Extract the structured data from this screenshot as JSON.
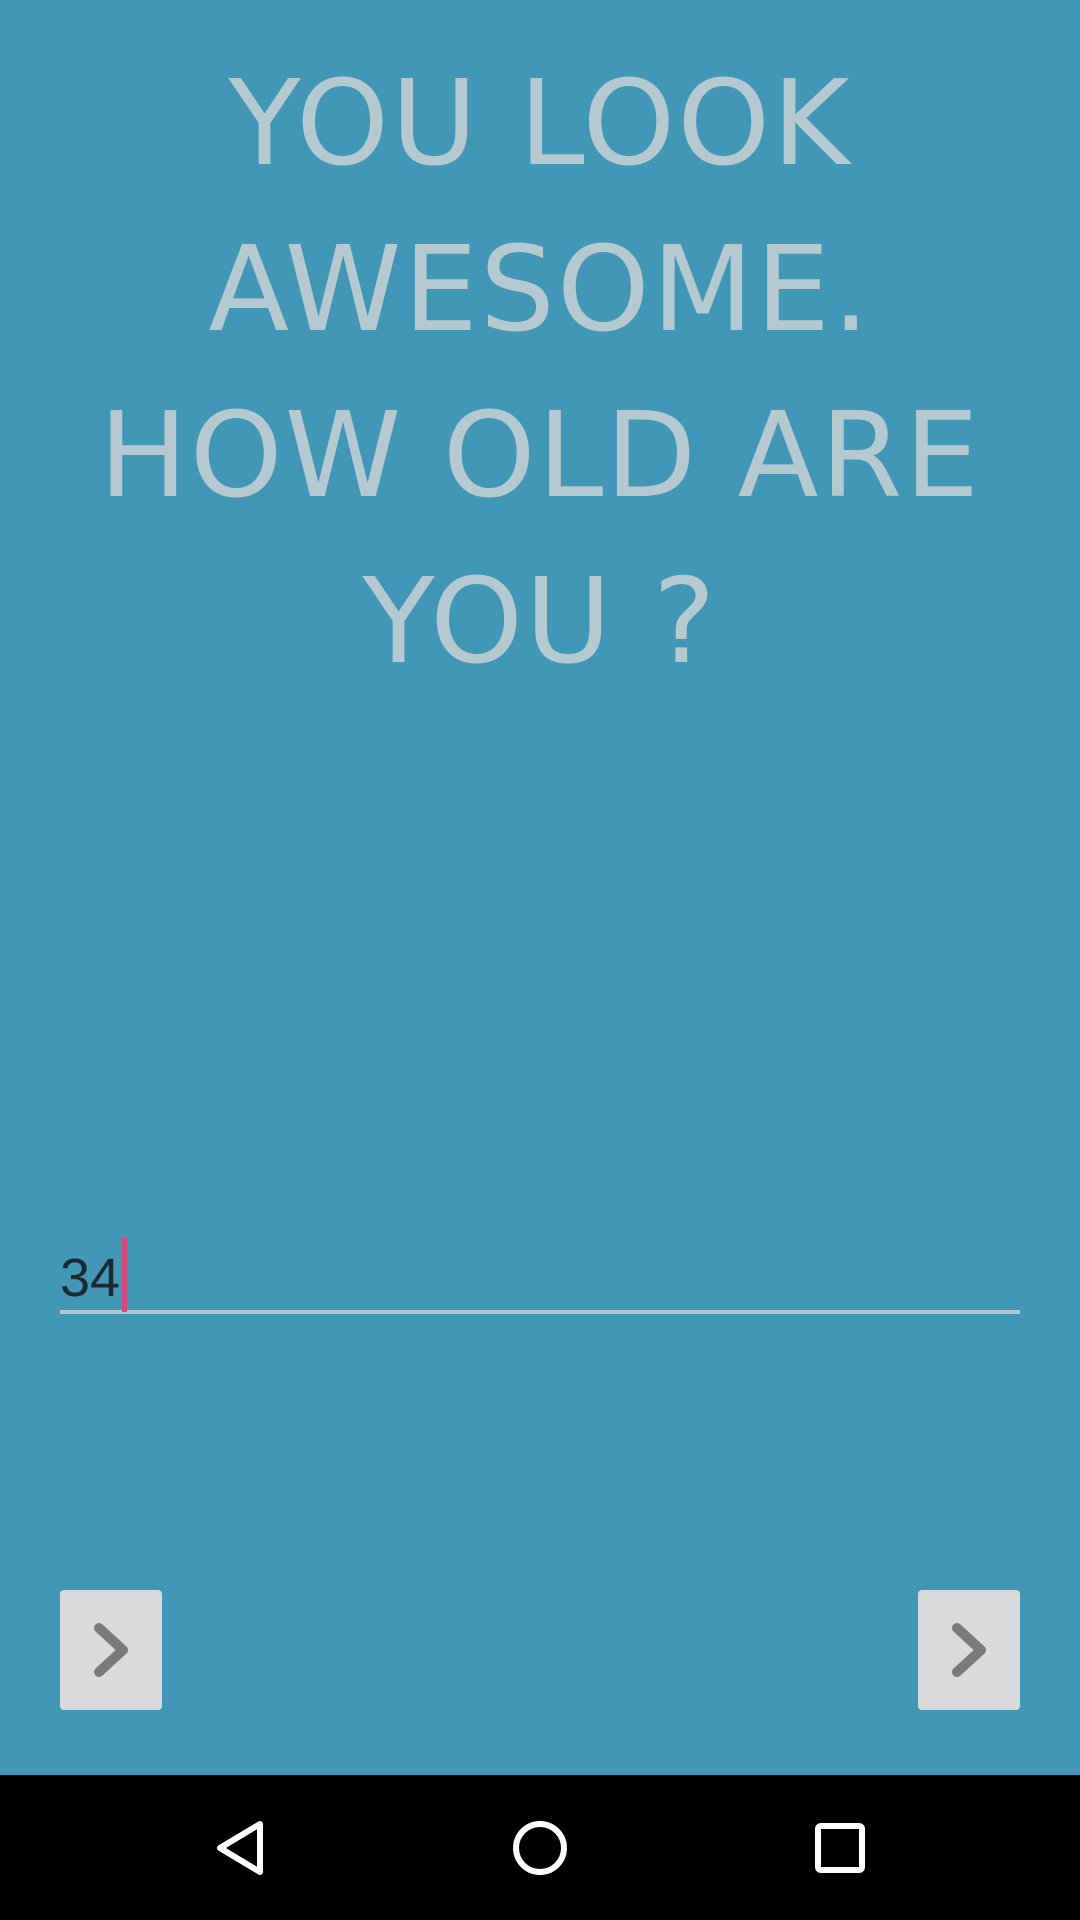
{
  "question": {
    "text": "YOU LOOK AWESOME. HOW OLD ARE YOU ?"
  },
  "age_input": {
    "value": "34"
  },
  "nav_buttons": [
    {
      "icon": "chevron-right-icon"
    },
    {
      "icon": "chevron-right-icon"
    }
  ],
  "system_nav": {
    "icons": [
      "back-triangle-icon",
      "home-circle-icon",
      "recents-square-icon"
    ]
  },
  "colors": {
    "background": "#4397b6",
    "question_text": "#b5c9d1",
    "caret": "#d4477f",
    "button_bg": "#d9dadb",
    "button_icon": "#7a7a7a"
  }
}
